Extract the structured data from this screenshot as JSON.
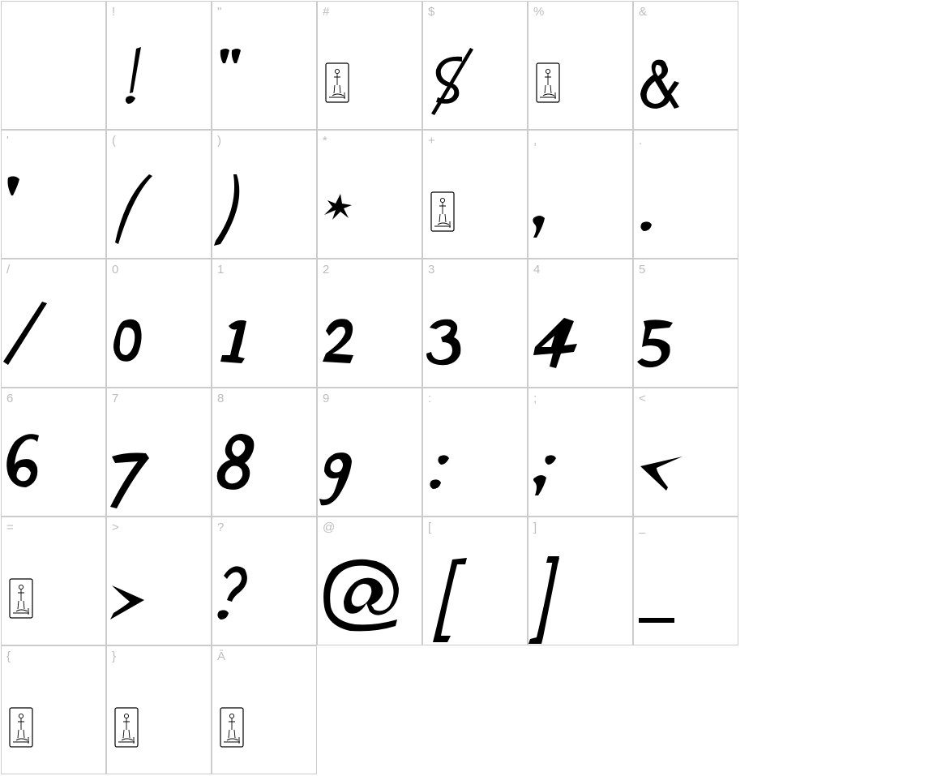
{
  "chart_data": {
    "type": "table",
    "characters": [
      {
        "label": "",
        "glyph": "blank"
      },
      {
        "label": "!",
        "glyph": "exclam"
      },
      {
        "label": "\"",
        "glyph": "quotedbl"
      },
      {
        "label": "#",
        "glyph": "missing"
      },
      {
        "label": "$",
        "glyph": "dollar"
      },
      {
        "label": "%",
        "glyph": "missing"
      },
      {
        "label": "&",
        "glyph": "ampersand"
      },
      {
        "label": "'",
        "glyph": "quotesingle"
      },
      {
        "label": "(",
        "glyph": "parenleft"
      },
      {
        "label": ")",
        "glyph": "parenright"
      },
      {
        "label": "*",
        "glyph": "asterisk"
      },
      {
        "label": "+",
        "glyph": "missing"
      },
      {
        "label": ",",
        "glyph": "comma"
      },
      {
        "label": ".",
        "glyph": "period"
      },
      {
        "label": "/",
        "glyph": "slash"
      },
      {
        "label": "0",
        "glyph": "zero"
      },
      {
        "label": "1",
        "glyph": "one"
      },
      {
        "label": "2",
        "glyph": "two"
      },
      {
        "label": "3",
        "glyph": "three"
      },
      {
        "label": "4",
        "glyph": "four"
      },
      {
        "label": "5",
        "glyph": "five"
      },
      {
        "label": "6",
        "glyph": "six"
      },
      {
        "label": "7",
        "glyph": "seven"
      },
      {
        "label": "8",
        "glyph": "eight"
      },
      {
        "label": "9",
        "glyph": "nine"
      },
      {
        "label": ":",
        "glyph": "colon"
      },
      {
        "label": ";",
        "glyph": "semicolon"
      },
      {
        "label": "<",
        "glyph": "less"
      },
      {
        "label": "=",
        "glyph": "missing"
      },
      {
        "label": ">",
        "glyph": "greater"
      },
      {
        "label": "?",
        "glyph": "question"
      },
      {
        "label": "@",
        "glyph": "at"
      },
      {
        "label": "[",
        "glyph": "bracketleft"
      },
      {
        "label": "]",
        "glyph": "bracketright"
      },
      {
        "label": "_",
        "glyph": "underscore"
      },
      {
        "label": "{",
        "glyph": "missing"
      },
      {
        "label": "}",
        "glyph": "missing"
      },
      {
        "label": "Ā",
        "glyph": "missing"
      }
    ]
  },
  "colors": {
    "border": "#cccccc",
    "label": "#bdbdbd",
    "glyph": "#000000",
    "background": "#ffffff"
  }
}
